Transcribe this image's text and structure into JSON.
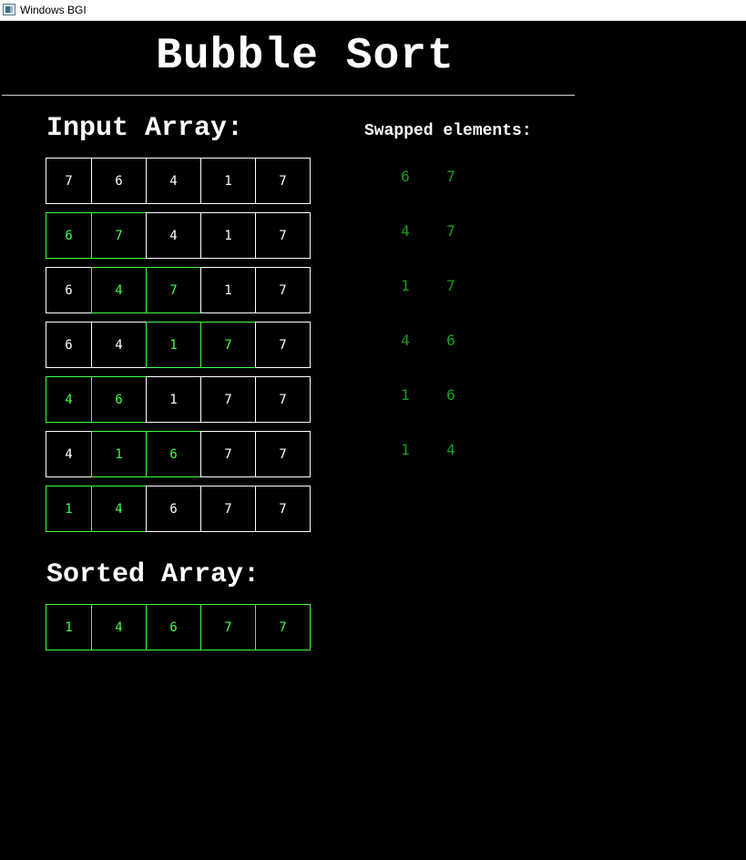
{
  "window": {
    "title": "Windows BGI"
  },
  "page": {
    "title": "Bubble Sort",
    "input_heading": "Input Array:",
    "swapped_heading": "Swapped elements:",
    "sorted_heading": "Sorted Array:"
  },
  "colors": {
    "background": "#000000",
    "default": "#ffffff",
    "highlight": "#40ff40",
    "swapped_text": "#12a012"
  },
  "passes": [
    {
      "values": [
        "7",
        "6",
        "4",
        "1",
        "7"
      ],
      "highlight": []
    },
    {
      "values": [
        "6",
        "7",
        "4",
        "1",
        "7"
      ],
      "highlight": [
        0,
        1
      ]
    },
    {
      "values": [
        "6",
        "4",
        "7",
        "1",
        "7"
      ],
      "highlight": [
        1,
        2
      ]
    },
    {
      "values": [
        "6",
        "4",
        "1",
        "7",
        "7"
      ],
      "highlight": [
        2,
        3
      ]
    },
    {
      "values": [
        "4",
        "6",
        "1",
        "7",
        "7"
      ],
      "highlight": [
        0,
        1
      ]
    },
    {
      "values": [
        "4",
        "1",
        "6",
        "7",
        "7"
      ],
      "highlight": [
        1,
        2
      ]
    },
    {
      "values": [
        "1",
        "4",
        "6",
        "7",
        "7"
      ],
      "highlight": [
        0,
        1
      ]
    }
  ],
  "sorted": [
    "1",
    "4",
    "6",
    "7",
    "7"
  ],
  "swaps": [
    [
      "6",
      "7"
    ],
    [
      "4",
      "7"
    ],
    [
      "1",
      "7"
    ],
    [
      "4",
      "6"
    ],
    [
      "1",
      "6"
    ],
    [
      "1",
      "4"
    ]
  ]
}
